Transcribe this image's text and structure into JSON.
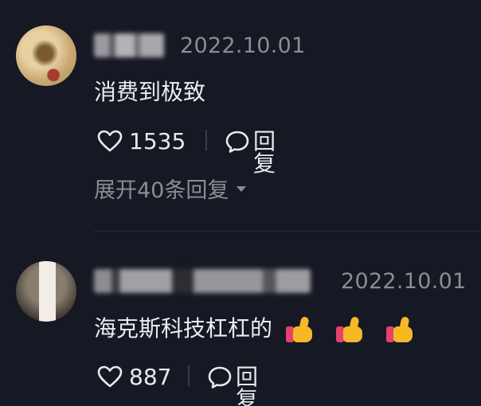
{
  "comments": [
    {
      "date": "2022.10.01",
      "content": "消费到极致",
      "likes": "1535",
      "reply_label": "回复",
      "expand_label": "展开40条回复",
      "icons": {
        "like": "heart-outline-icon",
        "reply": "chat-bubble-icon",
        "expand": "caret-down-icon"
      }
    },
    {
      "date": "2022.10.01",
      "content": "海克斯科技杠杠的",
      "likes": "887",
      "reply_label": "回复",
      "emoji_count": 3,
      "icons": {
        "like": "heart-outline-icon",
        "reply": "chat-bubble-icon",
        "emoji": "thumbs-up-icon"
      }
    }
  ],
  "colors": {
    "background": "#161823",
    "primary_text": "#ececee",
    "secondary_text": "#8c8c93",
    "emoji_thumb": "#f6b926",
    "emoji_cuff": "#e4416b"
  }
}
